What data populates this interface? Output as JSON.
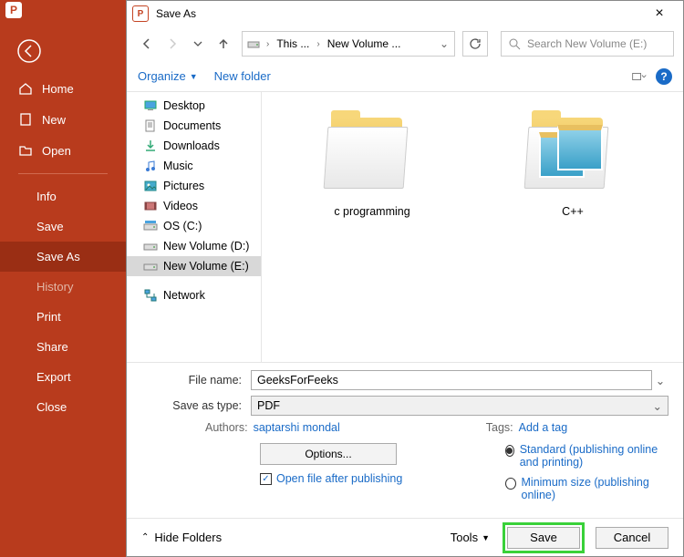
{
  "powerpoint_sidebar": {
    "back_icon": "back",
    "items": [
      {
        "label": "Home"
      },
      {
        "label": "New"
      },
      {
        "label": "Open"
      }
    ],
    "sub_items": [
      {
        "label": "Info"
      },
      {
        "label": "Save"
      },
      {
        "label": "Save As",
        "active": true
      },
      {
        "label": "History",
        "dim": true
      },
      {
        "label": "Print"
      },
      {
        "label": "Share"
      },
      {
        "label": "Export"
      },
      {
        "label": "Close"
      }
    ]
  },
  "dialog": {
    "title": "Save As",
    "close": "×",
    "breadcrumb": {
      "seg1": "This ...",
      "seg2": "New Volume ...",
      "dropdown": "⌄"
    },
    "search_placeholder": "Search New Volume (E:)",
    "toolbar": {
      "organize": "Organize",
      "new_folder": "New folder"
    },
    "tree": [
      {
        "icon": "desktop",
        "label": "Desktop"
      },
      {
        "icon": "doc",
        "label": "Documents"
      },
      {
        "icon": "download",
        "label": "Downloads"
      },
      {
        "icon": "music",
        "label": "Music"
      },
      {
        "icon": "picture",
        "label": "Pictures"
      },
      {
        "icon": "video",
        "label": "Videos"
      },
      {
        "icon": "drive",
        "label": "OS (C:)"
      },
      {
        "icon": "drive",
        "label": "New Volume (D:)"
      },
      {
        "icon": "drive",
        "label": "New Volume (E:)",
        "selected": true
      },
      {
        "icon": "network",
        "label": "Network",
        "gap": true
      }
    ],
    "folders": [
      {
        "name": "c programming"
      },
      {
        "name": "C++"
      }
    ],
    "form": {
      "filename_label": "File name:",
      "filename_value": "GeeksForFeeks",
      "type_label": "Save as type:",
      "type_value": "PDF",
      "authors_label": "Authors:",
      "authors_value": "saptarshi mondal",
      "tags_label": "Tags:",
      "tags_value": "Add a tag",
      "options_btn": "Options...",
      "open_after": "Open file after publishing",
      "radio_standard": "Standard (publishing online and printing)",
      "radio_min": "Minimum size (publishing online)"
    },
    "footer": {
      "hide_folders": "Hide Folders",
      "tools": "Tools",
      "save": "Save",
      "cancel": "Cancel"
    }
  }
}
